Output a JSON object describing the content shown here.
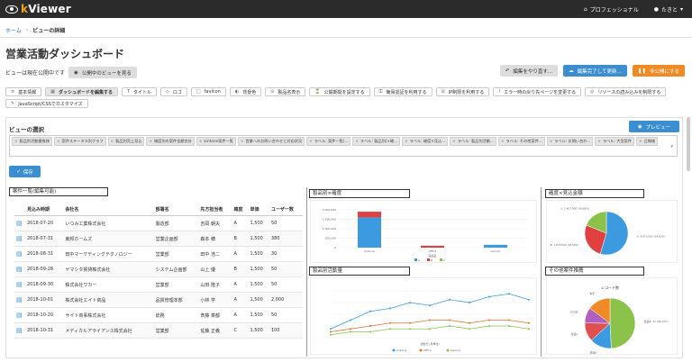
{
  "app": {
    "logo_prefix": "k",
    "logo_suffix": "Viewer",
    "plan": "プロフェッショナル",
    "user": "たきと"
  },
  "breadcrumb": {
    "home": "ホーム",
    "current": "ビューの詳細"
  },
  "page_title": "営業活動ダッシュボード",
  "publish": {
    "status": "ビューは現在公開中です",
    "view_button": "公開中のビューを見る"
  },
  "actions": {
    "undo": "編集をやり直す...",
    "finish": "編集完了して更新...",
    "unpublish": "非公開にする"
  },
  "tabs": [
    {
      "icon": "≡",
      "label": "基本情報"
    },
    {
      "icon": "▦",
      "label": "ダッシュボードを編集する"
    },
    {
      "icon": "T",
      "label": "タイトル"
    },
    {
      "icon": "◇",
      "label": "ロゴ"
    },
    {
      "icon": "□",
      "label": "favicon"
    },
    {
      "icon": "◐",
      "label": "背景色"
    },
    {
      "icon": "⊙",
      "label": "製品名表示"
    },
    {
      "icon": "⌛",
      "label": "公開期間を設定する"
    },
    {
      "icon": "⚿",
      "label": "簡易認証を利用する"
    },
    {
      "icon": "⊘",
      "label": "IP制限を利用する"
    },
    {
      "icon": "!",
      "label": "エラー時の戻り先ページを変更する"
    },
    {
      "icon": "◎",
      "label": "リソースの読み込みを制限する"
    },
    {
      "icon": "✎",
      "label": "JavaScript/CSSでカスタマイズ"
    }
  ],
  "view_select": {
    "label": "ビューの選択",
    "preview": "プレビュー",
    "chips": [
      "製品別活動量推移",
      "案件ステータス別グラフ",
      "製品別売上見込",
      "確度別の案件金額合計",
      "kintone案件一覧",
      "営業へのお問い合わせと対応状況",
      "ラベル: 案件一覧(...",
      "ラベル: 製品別(×確...",
      "ラベル: 確度×見込...",
      "ラベル: 製品別活動...",
      "ラベル: その他案件...",
      "ラベル: お問い合わ...",
      "ラベル: 大型案件",
      "日報帳"
    ]
  },
  "save_label": "保存",
  "panels": {
    "list": "案件一覧(編集可能)",
    "product_conf": "製品別×確度",
    "conf_amount": "確度×見込金額",
    "activity": "製品別活動量",
    "others": "その他案件推薦"
  },
  "table": {
    "columns": [
      "見込み時期",
      "会社名",
      "部署名",
      "先方担当者",
      "確度",
      "単価",
      "ユーザー数"
    ],
    "rows": [
      [
        "2018-07-20",
        "いつみ工業株式会社",
        "製造部",
        "吉岡 朝夫",
        "A",
        "1,500",
        "50"
      ],
      [
        "2018-07-31",
        "東邦ホームズ",
        "営業企画部",
        "森本 穂",
        "B",
        "1,500",
        "380"
      ],
      [
        "2018-08-31",
        "田中マーケティングテクノロジー",
        "営業部",
        "田中 浩二",
        "A",
        "1,500",
        "30"
      ],
      [
        "2018-09-28",
        "ヤマシタ賃貸株式会社",
        "システム企画部",
        "山上 優",
        "B",
        "1,500",
        "50"
      ],
      [
        "2018-09-30",
        "株式会社ワカー",
        "営業部",
        "山田 隆子",
        "A",
        "1,500",
        "50"
      ],
      [
        "2018-10-01",
        "株式会社エイト商品",
        "品質管理本部",
        "小林 学",
        "A",
        "1,500",
        "2,000"
      ],
      [
        "2018-10-20",
        "サイト商事株式会社",
        "総務",
        "斎藤 菜都",
        "A",
        "1,500",
        "50"
      ],
      [
        "2018-10-31",
        "メディカルアライアンス株式会社",
        "営業部",
        "佐藤 正義",
        "C",
        "1,500",
        "100"
      ]
    ]
  },
  "chart_data": [
    {
      "type": "bar",
      "title": "製品別×確度",
      "categories": [
        "kintone",
        "Office",
        "Garoon"
      ],
      "legend": [
        "A",
        "B",
        "C"
      ],
      "ylim": [
        0,
        2000000
      ],
      "yticks": [
        "2,000,000",
        "1,500,000",
        "1,000,000",
        "500,000",
        "0"
      ],
      "series": [
        {
          "name": "A",
          "values": [
            1600000,
            0,
            150000
          ],
          "color": "#3c9be0"
        },
        {
          "name": "B",
          "values": [
            300000,
            100000,
            0
          ],
          "color": "#e04040"
        },
        {
          "name": "C",
          "values": [
            0,
            0,
            0
          ],
          "color": "#8bc34a"
        }
      ],
      "xlabel": "製品名"
    },
    {
      "type": "pie",
      "title": "確度×見込金額",
      "slices": [
        {
          "label": "A: 4,070,000 (54.62%)",
          "value": 54.62,
          "color": "#3c9be0"
        },
        {
          "label": "B: 1,975,000 (26.50%)",
          "value": 26.5,
          "color": "#e04040"
        },
        {
          "label": "C: 1,407,000 (18.88%)",
          "value": 18.88,
          "color": "#8bc34a"
        }
      ]
    },
    {
      "type": "line",
      "title": "製品別活動量",
      "legend": [
        "kintone",
        "Office",
        "Garoon"
      ],
      "xlabel": "活動日 (月単位)",
      "series": [
        {
          "name": "kintone",
          "color": "#3c9be0",
          "values": [
            3,
            6,
            9,
            10,
            12,
            11,
            13,
            12,
            14,
            15,
            13
          ]
        },
        {
          "name": "Office",
          "color": "#e07030",
          "values": [
            2,
            3,
            4,
            5,
            5,
            6,
            6,
            5,
            6,
            6,
            5
          ]
        },
        {
          "name": "Garoon",
          "color": "#8bc34a",
          "values": [
            1,
            2,
            2,
            3,
            3,
            3,
            4,
            3,
            4,
            4,
            3
          ]
        }
      ]
    },
    {
      "type": "pie",
      "title": "その他案件推薦",
      "subtitle": "レコード数",
      "slices": [
        {
          "label": "製品B: 31 (49.21%)",
          "value": 49.21,
          "color": "#8bc34a"
        },
        {
          "label": "製品A",
          "value": 14,
          "color": "#3c9be0"
        },
        {
          "label": "製品C",
          "value": 12,
          "color": "#e05050"
        },
        {
          "label": "その他",
          "value": 10,
          "color": "#b05fc0"
        },
        {
          "label": "未定",
          "value": 14.79,
          "color": "#f08a24"
        }
      ]
    }
  ]
}
